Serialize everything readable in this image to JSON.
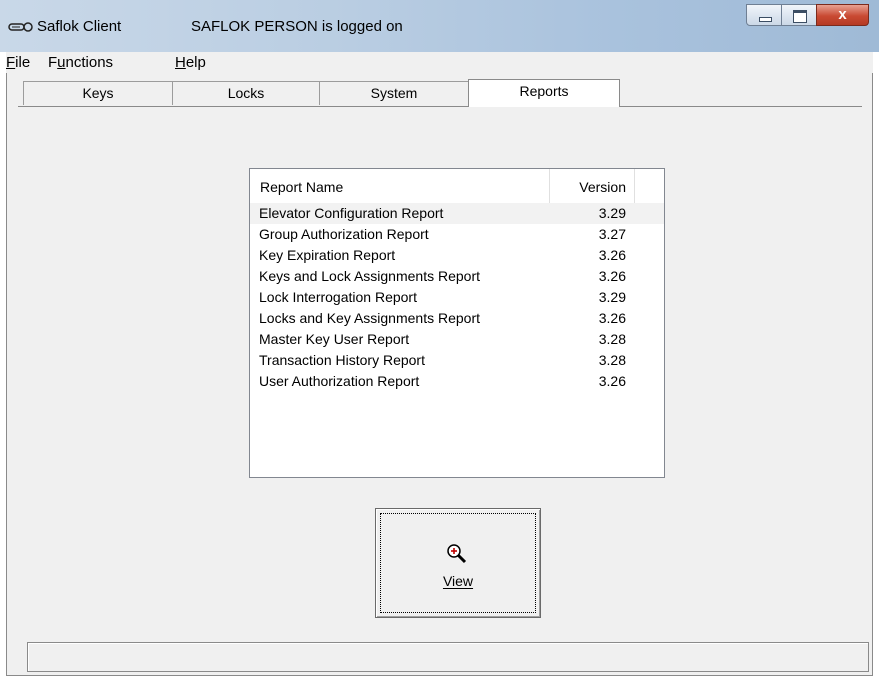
{
  "window": {
    "app_name": "Saflok Client",
    "status": "SAFLOK PERSON is logged on",
    "close_glyph": "x"
  },
  "menu": {
    "items": [
      {
        "mnemonic": "F",
        "rest": "ile"
      },
      {
        "pre": "F",
        "mnemonic": "u",
        "rest": "nctions"
      },
      {
        "mnemonic": "H",
        "rest": "elp"
      }
    ]
  },
  "tabs": [
    {
      "label": "Keys",
      "active": false
    },
    {
      "label": "Locks",
      "active": false
    },
    {
      "label": "System",
      "active": false
    },
    {
      "label": "Reports",
      "active": true
    }
  ],
  "reports": {
    "columns": {
      "name": "Report Name",
      "version": "Version"
    },
    "rows": [
      {
        "name": "Elevator Configuration Report",
        "version": "3.29"
      },
      {
        "name": "Group Authorization Report",
        "version": "3.27"
      },
      {
        "name": "Key Expiration Report",
        "version": "3.26"
      },
      {
        "name": "Keys and Lock Assignments Report",
        "version": "3.26"
      },
      {
        "name": "Lock Interrogation Report",
        "version": "3.29"
      },
      {
        "name": "Locks and Key Assignments Report",
        "version": "3.26"
      },
      {
        "name": "Master Key User Report",
        "version": "3.28"
      },
      {
        "name": "Transaction History Report",
        "version": "3.28"
      },
      {
        "name": "User Authorization Report",
        "version": "3.26"
      }
    ]
  },
  "view_button": {
    "label": "View",
    "icon": "zoom-in-icon"
  },
  "status_bar": {
    "text": ""
  }
}
